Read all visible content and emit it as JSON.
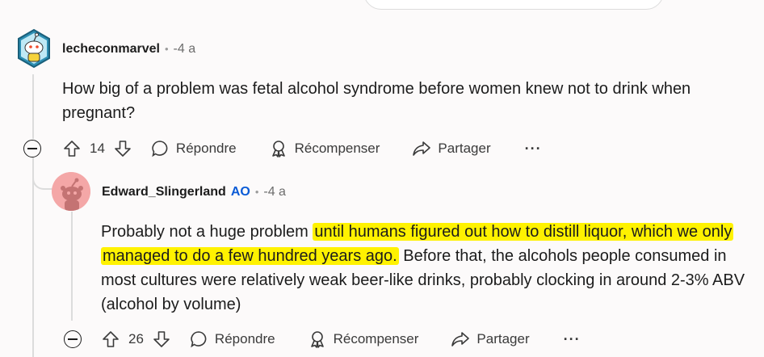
{
  "comments": [
    {
      "username": "lecheconmarvel",
      "time": "-4 a",
      "text": "How big of a problem was fetal alcohol syndrome before women knew not to drink when pregnant?",
      "votes": "14",
      "actions": {
        "reply": "Répondre",
        "award": "Récompenser",
        "share": "Partager",
        "more": "···"
      }
    },
    {
      "username": "Edward_Slingerland",
      "badge": "AO",
      "time": "-4 a",
      "text_before": "Probably not a huge problem ",
      "text_highlight": "until humans figured out how to distill liquor, which we only managed to do a few hundred years ago.",
      "text_after": " Before that, the alcohols people consumed in most cultures were relatively weak beer-like drinks, probably clocking in around 2-3% ABV (alcohol by volume)",
      "votes": "26",
      "actions": {
        "reply": "Répondre",
        "award": "Récompenser",
        "share": "Partager",
        "more": "···"
      }
    }
  ],
  "colors": {
    "highlight": "#fff200",
    "op_badge": "#0a5bd6",
    "avatar2_bg": "#f4a7a7"
  }
}
